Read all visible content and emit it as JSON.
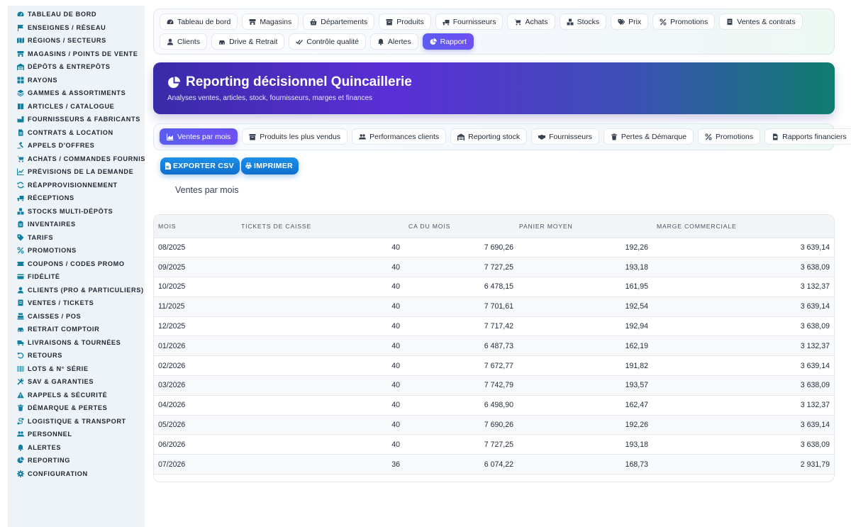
{
  "sidebar": {
    "items": [
      {
        "label": "TABLEAU DE BORD",
        "icon": "gauge-icon"
      },
      {
        "label": "ENSEIGNES / RÉSEAU",
        "icon": "flag-icon"
      },
      {
        "label": "RÉGIONS / SECTEURS",
        "icon": "map-icon"
      },
      {
        "label": "MAGASINS / POINTS DE VENTE",
        "icon": "store-icon"
      },
      {
        "label": "DÉPÔTS & ENTREPÔTS",
        "icon": "warehouse-icon"
      },
      {
        "label": "RAYONS",
        "icon": "grid-icon"
      },
      {
        "label": "GAMMES & ASSORTIMENTS",
        "icon": "layers-icon"
      },
      {
        "label": "ARTICLES / CATALOGUE",
        "icon": "book-icon"
      },
      {
        "label": "FOURNISSEURS & FABRICANTS",
        "icon": "factory-icon"
      },
      {
        "label": "CONTRATS & LOCATION",
        "icon": "file-icon"
      },
      {
        "label": "APPELS D'OFFRES",
        "icon": "gavel-icon"
      },
      {
        "label": "ACHATS / COMMANDES FOURNISSEURS",
        "icon": "cart-icon"
      },
      {
        "label": "PRÉVISIONS DE LA DEMANDE",
        "icon": "chart-line-icon"
      },
      {
        "label": "RÉAPPROVISIONNEMENT",
        "icon": "sync-icon"
      },
      {
        "label": "RÉCEPTIONS",
        "icon": "truck-loading-icon"
      },
      {
        "label": "STOCKS MULTI-DÉPÔTS",
        "icon": "boxes-icon"
      },
      {
        "label": "INVENTAIRES",
        "icon": "clipboard-icon"
      },
      {
        "label": "TARIFS",
        "icon": "tag-icon"
      },
      {
        "label": "PROMOTIONS",
        "icon": "percent-icon"
      },
      {
        "label": "COUPONS / CODES PROMO",
        "icon": "ticket-icon"
      },
      {
        "label": "FIDÉLITÉ",
        "icon": "card-icon"
      },
      {
        "label": "CLIENTS (PRO & PARTICULIERS)",
        "icon": "user-icon"
      },
      {
        "label": "VENTES / TICKETS",
        "icon": "receipt-icon"
      },
      {
        "label": "CAISSES / POS",
        "icon": "cash-register-icon"
      },
      {
        "label": "RETRAIT COMPTOIR",
        "icon": "car-icon"
      },
      {
        "label": "LIVRAISONS & TOURNÉES",
        "icon": "truck-icon"
      },
      {
        "label": "RETOURS",
        "icon": "undo-icon"
      },
      {
        "label": "LOTS & N° SÉRIE",
        "icon": "barcode-icon"
      },
      {
        "label": "SAV & GARANTIES",
        "icon": "tools-icon"
      },
      {
        "label": "RAPPELS & SÉCURITÉ",
        "icon": "warning-icon"
      },
      {
        "label": "DÉMARQUE & PERTES",
        "icon": "trash-icon"
      },
      {
        "label": "LOGISTIQUE & TRANSPORT",
        "icon": "route-icon"
      },
      {
        "label": "PERSONNEL",
        "icon": "users-icon"
      },
      {
        "label": "ALERTES",
        "icon": "bell-icon"
      },
      {
        "label": "REPORTING",
        "icon": "pie-icon"
      },
      {
        "label": "CONFIGURATION",
        "icon": "gear-icon"
      }
    ]
  },
  "topnav": {
    "items": [
      {
        "label": "Tableau de bord",
        "icon": "gauge-icon",
        "active": false
      },
      {
        "label": "Magasins",
        "icon": "store-icon",
        "active": false
      },
      {
        "label": "Départements",
        "icon": "basket-icon",
        "active": false
      },
      {
        "label": "Produits",
        "icon": "box-icon",
        "active": false
      },
      {
        "label": "Fournisseurs",
        "icon": "truck-loading-icon",
        "active": false
      },
      {
        "label": "Achats",
        "icon": "cart-icon",
        "active": false
      },
      {
        "label": "Stocks",
        "icon": "boxes-icon",
        "active": false
      },
      {
        "label": "Prix",
        "icon": "tags-icon",
        "active": false
      },
      {
        "label": "Promotions",
        "icon": "percent-icon",
        "active": false
      },
      {
        "label": "Ventes & contrats",
        "icon": "receipt-icon",
        "active": false
      },
      {
        "label": "Clients",
        "icon": "user-icon",
        "active": false
      },
      {
        "label": "Drive & Retrait",
        "icon": "car-icon",
        "active": false
      },
      {
        "label": "Contrôle qualité",
        "icon": "check-double-icon",
        "active": false
      },
      {
        "label": "Alertes",
        "icon": "bell-icon",
        "active": false
      },
      {
        "label": "Rapport",
        "icon": "pie-icon",
        "active": true
      }
    ]
  },
  "hero": {
    "title": "Reporting décisionnel Quincaillerie",
    "subtitle": "Analyses ventes, articles, stock, fournisseurs, marges et finances",
    "icon": "pie-icon"
  },
  "subtabs": {
    "items": [
      {
        "label": "Ventes par mois",
        "icon": "chart-area-icon",
        "active": true
      },
      {
        "label": "Produits les plus vendus",
        "icon": "box-icon",
        "active": false
      },
      {
        "label": "Performances clients",
        "icon": "users-icon",
        "active": false
      },
      {
        "label": "Reporting stock",
        "icon": "warehouse-icon",
        "active": false
      },
      {
        "label": "Fournisseurs",
        "icon": "handshake-icon",
        "active": false
      },
      {
        "label": "Pertes & Démarque",
        "icon": "trash-icon",
        "active": false
      },
      {
        "label": "Promotions",
        "icon": "percent-icon",
        "active": false
      },
      {
        "label": "Rapports financiers",
        "icon": "file-invoice-icon",
        "active": false
      }
    ]
  },
  "actions": {
    "export_label": "EXPORTER CSV",
    "print_label": "IMPRIMER"
  },
  "section": {
    "title": "Ventes par mois"
  },
  "table": {
    "headers": [
      "MOIS",
      "TICKETS DE CAISSE",
      "CA DU MOIS",
      "PANIER MOYEN",
      "MARGE COMMERCIALE"
    ],
    "rows": [
      [
        "08/2025",
        "40",
        "7 690,26",
        "192,26",
        "3 639,14"
      ],
      [
        "09/2025",
        "40",
        "7 727,25",
        "193,18",
        "3 638,09"
      ],
      [
        "10/2025",
        "40",
        "6 478,15",
        "161,95",
        "3 132,37"
      ],
      [
        "11/2025",
        "40",
        "7 701,61",
        "192,54",
        "3 639,14"
      ],
      [
        "12/2025",
        "40",
        "7 717,42",
        "192,94",
        "3 638,09"
      ],
      [
        "01/2026",
        "40",
        "6 487,73",
        "162,19",
        "3 132,37"
      ],
      [
        "02/2026",
        "40",
        "7 672,77",
        "191,82",
        "3 639,14"
      ],
      [
        "03/2026",
        "40",
        "7 742,79",
        "193,57",
        "3 638,09"
      ],
      [
        "04/2026",
        "40",
        "6 498,90",
        "162,47",
        "3 132,37"
      ],
      [
        "05/2026",
        "40",
        "7 690,26",
        "192,26",
        "3 639,14"
      ],
      [
        "06/2026",
        "40",
        "7 727,25",
        "193,18",
        "3 638,09"
      ],
      [
        "07/2026",
        "36",
        "6 074,22",
        "168,73",
        "2 931,79"
      ]
    ]
  },
  "colors": {
    "accent": "#5b5cf0",
    "sidebar_icon": "#0e7fa0",
    "action_button": "#1480dc",
    "hero_start": "#3a2ba8",
    "hero_end": "#0f7c6e"
  }
}
